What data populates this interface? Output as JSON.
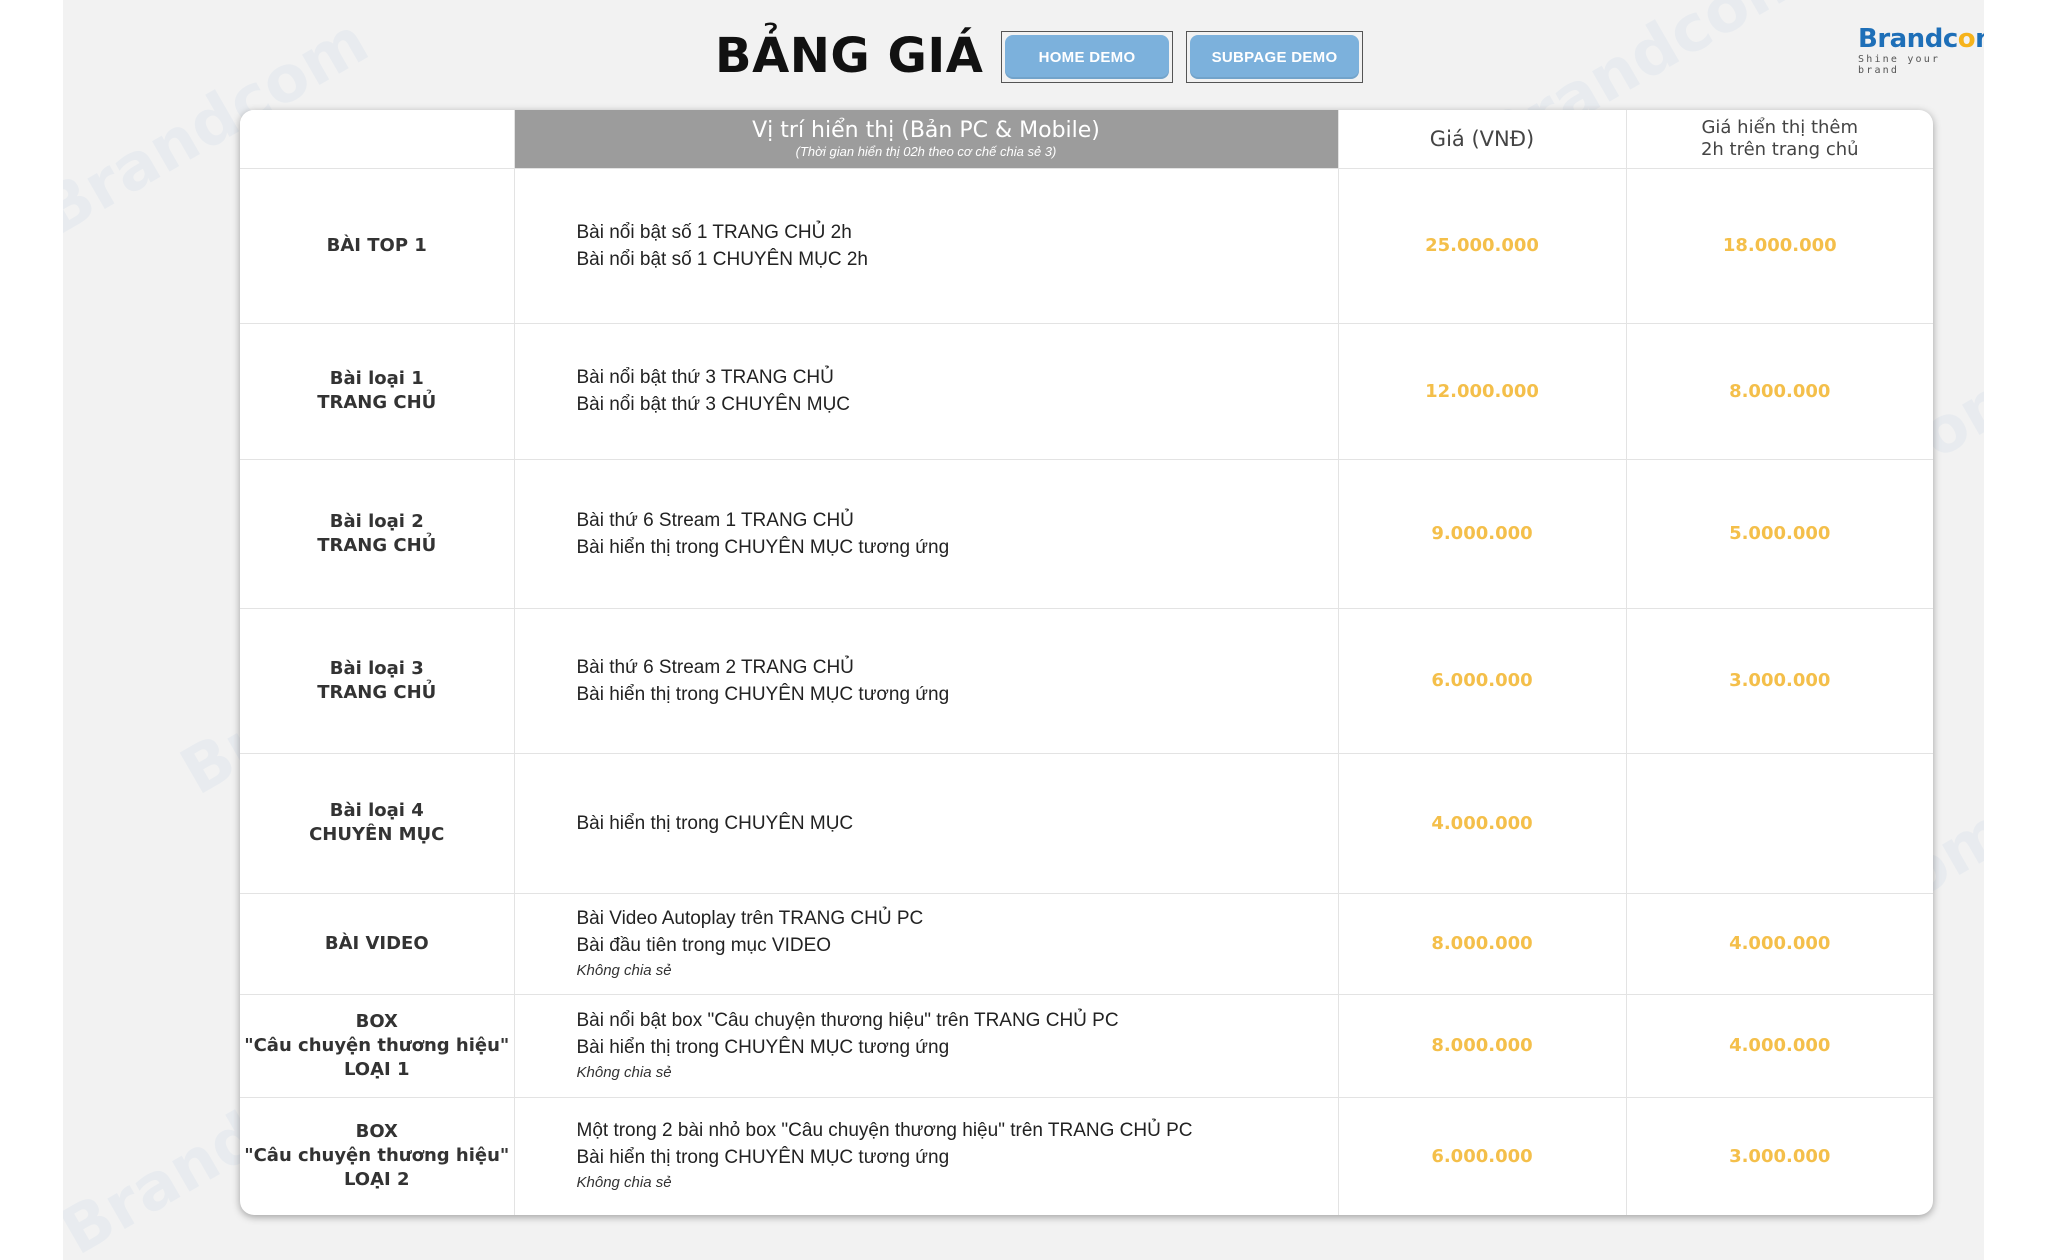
{
  "header": {
    "title": "BẢNG GIÁ",
    "home_demo": "HOME DEMO",
    "subpage_demo": "SUBPAGE DEMO"
  },
  "logo": {
    "brand_start": "Brand",
    "brand_o": "o",
    "brand_c": "c",
    "brand_end": "m",
    "tagline": "Shine your brand",
    "watermark": "Brandcom"
  },
  "table": {
    "headers": {
      "position": "Vị trí hiển thị (Bản PC & Mobile)",
      "position_note": "(Thời gian hiển thị 02h theo cơ chế chia sẻ 3)",
      "price": "Giá (VNĐ)",
      "extra_line1": "Giá hiển thị thêm",
      "extra_line2": "2h trên trang chủ"
    },
    "rows": [
      {
        "name1": "BÀI TOP 1",
        "name2": "",
        "name3": "",
        "desc1": "Bài nổi bật số 1 TRANG CHỦ 2h",
        "desc2": "Bài nổi bật số 1 CHUYÊN MỤC 2h",
        "note": "",
        "price": "25.000.000",
        "extra": "18.000.000"
      },
      {
        "name1": "Bài loại 1",
        "name2": "TRANG CHỦ",
        "name3": "",
        "desc1": "Bài nổi bật thứ 3 TRANG CHỦ",
        "desc2": "Bài nổi bật thứ 3 CHUYÊN MỤC",
        "note": "",
        "price": "12.000.000",
        "extra": "8.000.000"
      },
      {
        "name1": "Bài loại 2",
        "name2": "TRANG CHỦ",
        "name3": "",
        "desc1": "Bài thứ 6 Stream 1 TRANG CHỦ",
        "desc2": "Bài hiển thị trong CHUYÊN MỤC tương ứng",
        "note": "",
        "price": "9.000.000",
        "extra": "5.000.000"
      },
      {
        "name1": "Bài loại 3",
        "name2": "TRANG CHỦ",
        "name3": "",
        "desc1": "Bài thứ 6 Stream 2 TRANG CHỦ",
        "desc2": "Bài hiển thị trong CHUYÊN MỤC tương ứng",
        "note": "",
        "price": "6.000.000",
        "extra": "3.000.000"
      },
      {
        "name1": "Bài loại 4",
        "name2": "CHUYÊN MỤC",
        "name3": "",
        "desc1": "Bài hiển thị trong CHUYÊN MỤC",
        "desc2": "",
        "note": "",
        "price": "4.000.000",
        "extra": ""
      },
      {
        "name1": "BÀI VIDEO",
        "name2": "",
        "name3": "",
        "desc1": "Bài Video Autoplay trên TRANG CHỦ PC",
        "desc2": "Bài đầu tiên trong mục VIDEO",
        "note": "Không chia sẻ",
        "price": "8.000.000",
        "extra": "4.000.000"
      },
      {
        "name1": "BOX",
        "name2": "\"Câu chuyện thương hiệu\"",
        "name3": "LOẠI 1",
        "desc1": "Bài nổi bật box \"Câu chuyện thương hiệu\" trên TRANG CHỦ PC",
        "desc2": "Bài hiển thị trong CHUYÊN MỤC tương ứng",
        "note": "Không chia sẻ",
        "price": "8.000.000",
        "extra": "4.000.000"
      },
      {
        "name1": "BOX",
        "name2": "\"Câu chuyện thương hiệu\"",
        "name3": "LOẠI 2",
        "desc1": "Một trong 2 bài nhỏ box \"Câu chuyện thương hiệu\" trên TRANG CHỦ PC",
        "desc2": "Bài hiển thị trong CHUYÊN MỤC tương ứng",
        "note": "Không chia sẻ",
        "price": "6.000.000",
        "extra": "3.000.000"
      }
    ]
  },
  "colors": {
    "price": "#f4bf4a",
    "header_gray": "#9c9c9c",
    "button_blue": "#7cb1dc",
    "brand_blue": "#1e6fb8",
    "brand_orange": "#f6b31b"
  }
}
